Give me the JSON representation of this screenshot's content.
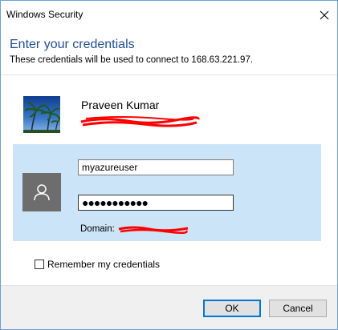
{
  "window": {
    "title": "Windows Security"
  },
  "dialog": {
    "heading": "Enter your credentials",
    "subheading": "These credentials will be used to connect to 168.63.221.97."
  },
  "account": {
    "name": "Praveen Kumar",
    "avatar_icon": "palm-tree-photo",
    "redacted_marker": "PE"
  },
  "credentials": {
    "user_icon": "user-silhouette-icon",
    "username_value": "myazureuser",
    "password_value": "●●●●●●●●●●●",
    "domain_label": "Domain:",
    "domain_value_prefix": "PE"
  },
  "remember": {
    "label": "Remember my credentials",
    "checked": false
  },
  "buttons": {
    "ok_label": "OK",
    "cancel_label": "Cancel"
  },
  "colors": {
    "accent": "#0078d7",
    "heading": "#1f4e9c",
    "panel": "#cce4f7",
    "redaction": "#ff0000"
  }
}
